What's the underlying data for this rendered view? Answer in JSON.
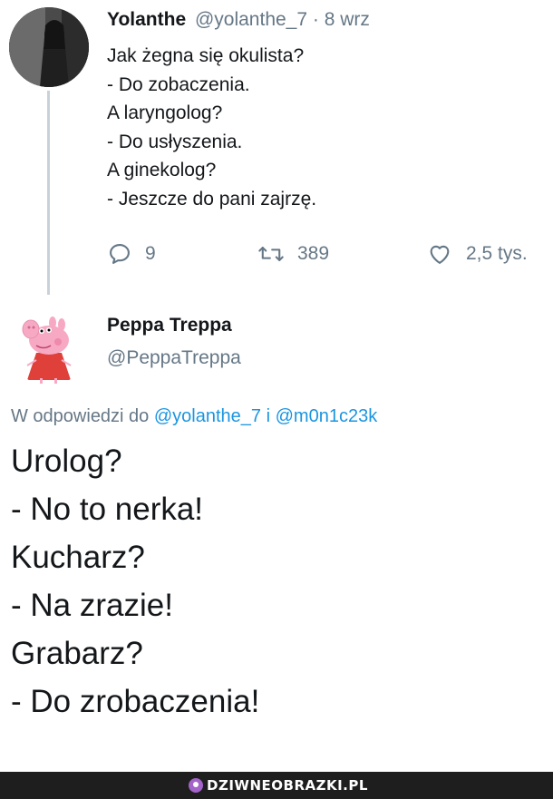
{
  "tweet1": {
    "name": "Yolanthe",
    "handle": "@yolanthe_7",
    "separator": "·",
    "time": "8 wrz",
    "lines": [
      "Jak żegna się okulista?",
      "- Do zobaczenia.",
      "A laryngolog?",
      "- Do usłyszenia.",
      "A ginekolog?",
      "- Jeszcze do pani zajrzę."
    ],
    "actions": {
      "reply_count": "9",
      "retweet_count": "389",
      "like_count": "2,5 tys."
    },
    "icons": [
      "reply-icon",
      "retweet-icon",
      "like-icon"
    ]
  },
  "tweet2": {
    "name": "Peppa Treppa",
    "handle": "@PeppaTreppa",
    "reply_prefix": "W odpowiedzi do",
    "reply_mention1": "@yolanthe_7",
    "reply_joiner": "i",
    "reply_mention2": "@m0n1c23k",
    "lines": [
      "Urolog?",
      "- No to nerka!",
      "Kucharz?",
      "- Na zrazie!",
      "Grabarz?",
      "- Do zrobaczenia!"
    ]
  },
  "footer": {
    "watermark": "DZIWNEOBRAZKI.PL"
  },
  "colors": {
    "text": "#14171a",
    "secondary": "#657786",
    "link": "#1b95e0",
    "thread_line": "#c9d1d8",
    "footer_bg": "#1e1e1e",
    "peppa_pink": "#f7a9c4",
    "peppa_dress": "#e0403a"
  }
}
